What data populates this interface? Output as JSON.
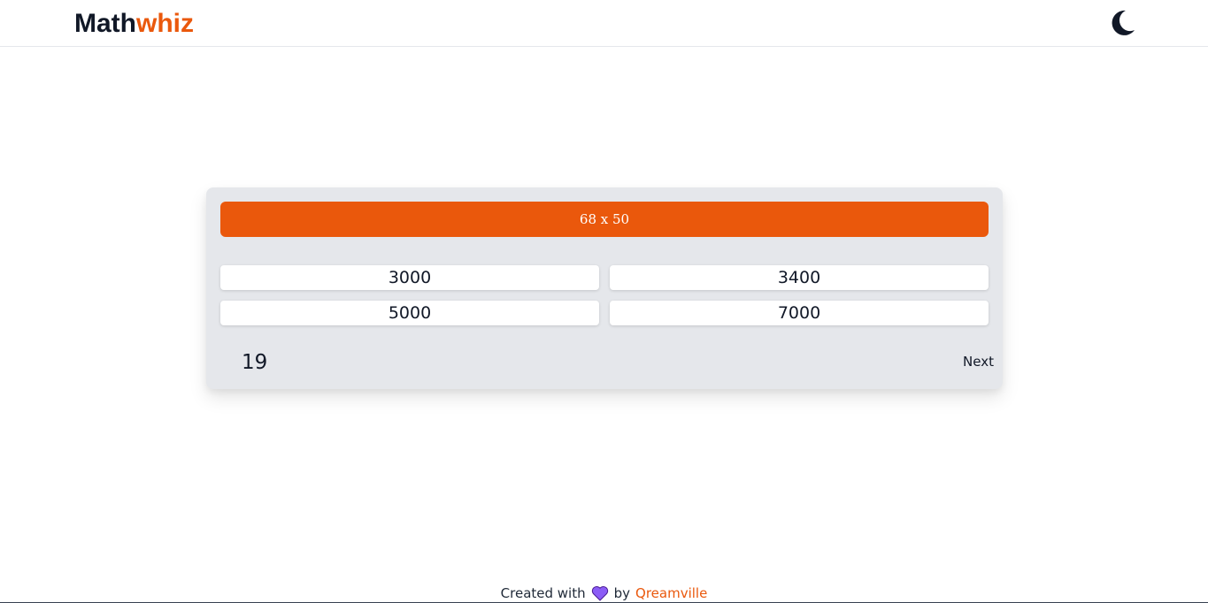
{
  "header": {
    "logo_part1": "Math",
    "logo_part2": "whiz",
    "theme_icon": "moon-icon"
  },
  "quiz": {
    "question": "68 x 50",
    "options": [
      "3000",
      "3400",
      "5000",
      "7000"
    ],
    "timer": "19",
    "next_label": "Next"
  },
  "footer": {
    "created_text": "Created with",
    "heart_icon": "heart-icon",
    "by_text": "by",
    "author_link": "Qreamville"
  },
  "colors": {
    "accent": "#ea580c",
    "card_bg": "#e5e7eb",
    "text_dark": "#111827",
    "heart": "#8b5cf6"
  }
}
